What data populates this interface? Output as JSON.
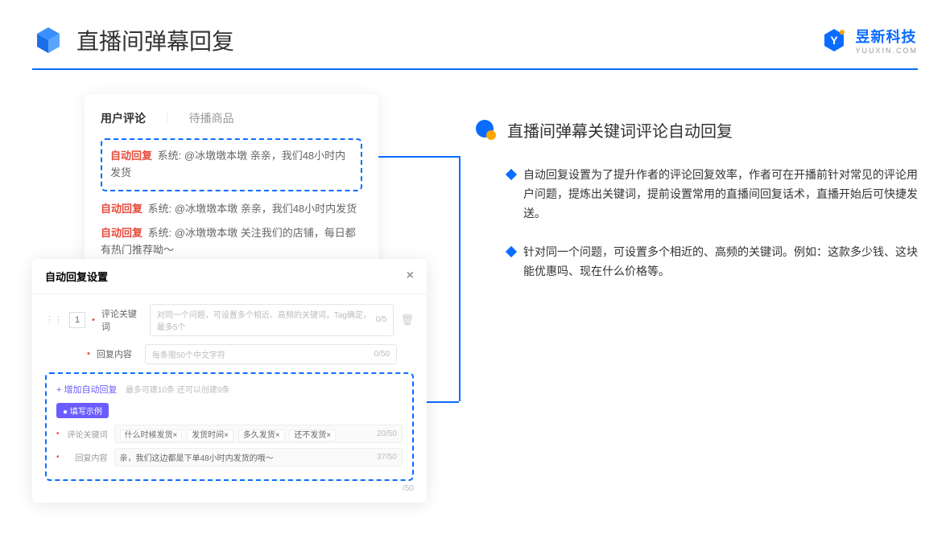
{
  "header": {
    "title": "直播间弹幕回复",
    "brand": "昱新科技",
    "brandSub": "YUUXIN.COM"
  },
  "comments": {
    "tabActive": "用户评论",
    "tab2": "待播商品",
    "tagAuto": "自动回复",
    "sys": "系统:",
    "c1": "@冰墩墩本墩 亲亲，我们48小时内发货",
    "c2": "@冰墩墩本墩 亲亲，我们48小时内发货",
    "c3": "@冰墩墩本墩 关注我们的店铺，每日都有热门推荐呦～"
  },
  "settings": {
    "title": "自动回复设置",
    "idx": "1",
    "kwLabel": "评论关键词",
    "kwPlaceholder": "对同一个问题，可设置多个相近、高频的关键词，Tag确定，最多5个",
    "kwCount": "0/5",
    "contentLabel": "回复内容",
    "contentPlaceholder": "每条限50个中文字符",
    "contentCount": "0/50",
    "addLink": "+ 增加自动回复",
    "addHint": "最多可建10条 还可以创建9条",
    "badge": "● 填写示例",
    "exKw": "评论关键词",
    "exKwCount": "20/50",
    "exContent": "回复内容",
    "exContentText": "亲，我们这边都是下单48小时内发货的哦～",
    "exContentCount": "37/50",
    "chips": [
      "什么时候发货×",
      "发货时间×",
      "多久发货×",
      "还不发货×"
    ],
    "bottomCount": "/50"
  },
  "right": {
    "title": "直播间弹幕关键词评论自动回复",
    "p1": "自动回复设置为了提升作者的评论回复效率，作者可在开播前针对常见的评论用户问题，提炼出关键词，提前设置常用的直播间回复话术，直播开始后可快捷发送。",
    "p2": "针对同一个问题，可设置多个相近的、高频的关键词。例如：这款多少钱、这块能优惠吗、现在什么价格等。"
  }
}
